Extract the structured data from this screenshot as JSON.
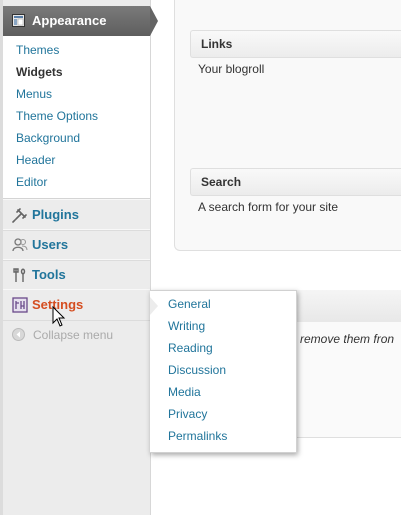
{
  "sidebar": {
    "appearance": {
      "label": "Appearance",
      "submenu": [
        "Themes",
        "Widgets",
        "Menus",
        "Theme Options",
        "Background",
        "Header",
        "Editor"
      ],
      "current": "Widgets"
    },
    "items": [
      {
        "label": "Plugins",
        "icon": "plug-icon"
      },
      {
        "label": "Users",
        "icon": "users-icon"
      },
      {
        "label": "Tools",
        "icon": "tools-icon"
      },
      {
        "label": "Settings",
        "icon": "settings-icon"
      }
    ],
    "collapse_label": "Collapse menu"
  },
  "settings_flyout": {
    "items": [
      "General",
      "Writing",
      "Reading",
      "Discussion",
      "Media",
      "Privacy",
      "Permalinks"
    ]
  },
  "widgets": [
    {
      "title": "Links",
      "description": "Your blogroll"
    },
    {
      "title": "Search",
      "description": "A search form for your site"
    }
  ],
  "inactive_note": "o remove them fron",
  "colors": {
    "link": "#21759b",
    "active_menu": "#d54e21",
    "appearance_header": "#6d6d6d",
    "sidebar_bg": "#ececec"
  }
}
